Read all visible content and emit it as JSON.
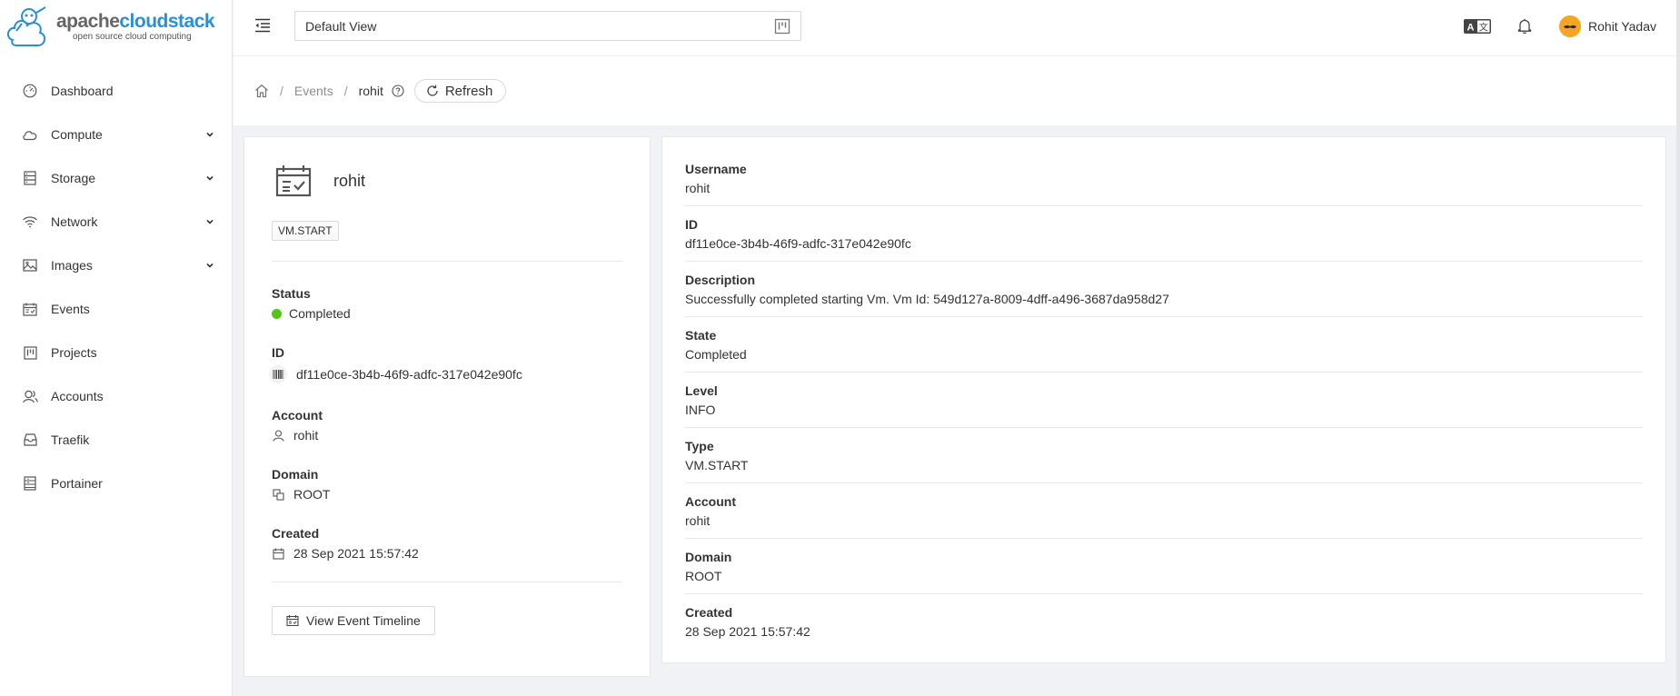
{
  "logo": {
    "brand_plain": "apache",
    "brand_colored": "cloudstack",
    "tagline": "open source cloud computing"
  },
  "sidebar": {
    "items": [
      {
        "label": "Dashboard",
        "icon": "dashboard-icon",
        "expandable": false
      },
      {
        "label": "Compute",
        "icon": "cloud-icon",
        "expandable": true
      },
      {
        "label": "Storage",
        "icon": "database-icon",
        "expandable": true
      },
      {
        "label": "Network",
        "icon": "wifi-icon",
        "expandable": true
      },
      {
        "label": "Images",
        "icon": "picture-icon",
        "expandable": true
      },
      {
        "label": "Events",
        "icon": "schedule-icon",
        "expandable": false
      },
      {
        "label": "Projects",
        "icon": "project-icon",
        "expandable": false
      },
      {
        "label": "Accounts",
        "icon": "team-icon",
        "expandable": false
      },
      {
        "label": "Traefik",
        "icon": "inbox-icon",
        "expandable": false
      },
      {
        "label": "Portainer",
        "icon": "container-icon",
        "expandable": false
      }
    ]
  },
  "header": {
    "view_select": "Default View",
    "user_name": "Rohit Yadav"
  },
  "breadcrumb": {
    "parent": "Events",
    "current": "rohit",
    "refresh_label": "Refresh"
  },
  "resource": {
    "name": "rohit",
    "tag": "VM.START",
    "status_label": "Status",
    "status_value": "Completed",
    "status_color": "#52c41a",
    "id_label": "ID",
    "id_value": "df11e0ce-3b4b-46f9-adfc-317e042e90fc",
    "account_label": "Account",
    "account_value": "rohit",
    "domain_label": "Domain",
    "domain_value": "ROOT",
    "created_label": "Created",
    "created_value": "28 Sep 2021 15:57:42",
    "timeline_button": "View Event Timeline"
  },
  "details": [
    {
      "label": "Username",
      "value": "rohit"
    },
    {
      "label": "ID",
      "value": "df11e0ce-3b4b-46f9-adfc-317e042e90fc"
    },
    {
      "label": "Description",
      "value": "Successfully completed starting Vm. Vm Id: 549d127a-8009-4dff-a496-3687da958d27"
    },
    {
      "label": "State",
      "value": "Completed"
    },
    {
      "label": "Level",
      "value": "INFO"
    },
    {
      "label": "Type",
      "value": "VM.START"
    },
    {
      "label": "Account",
      "value": "rohit"
    },
    {
      "label": "Domain",
      "value": "ROOT"
    },
    {
      "label": "Created",
      "value": "28 Sep 2021 15:57:42"
    }
  ]
}
